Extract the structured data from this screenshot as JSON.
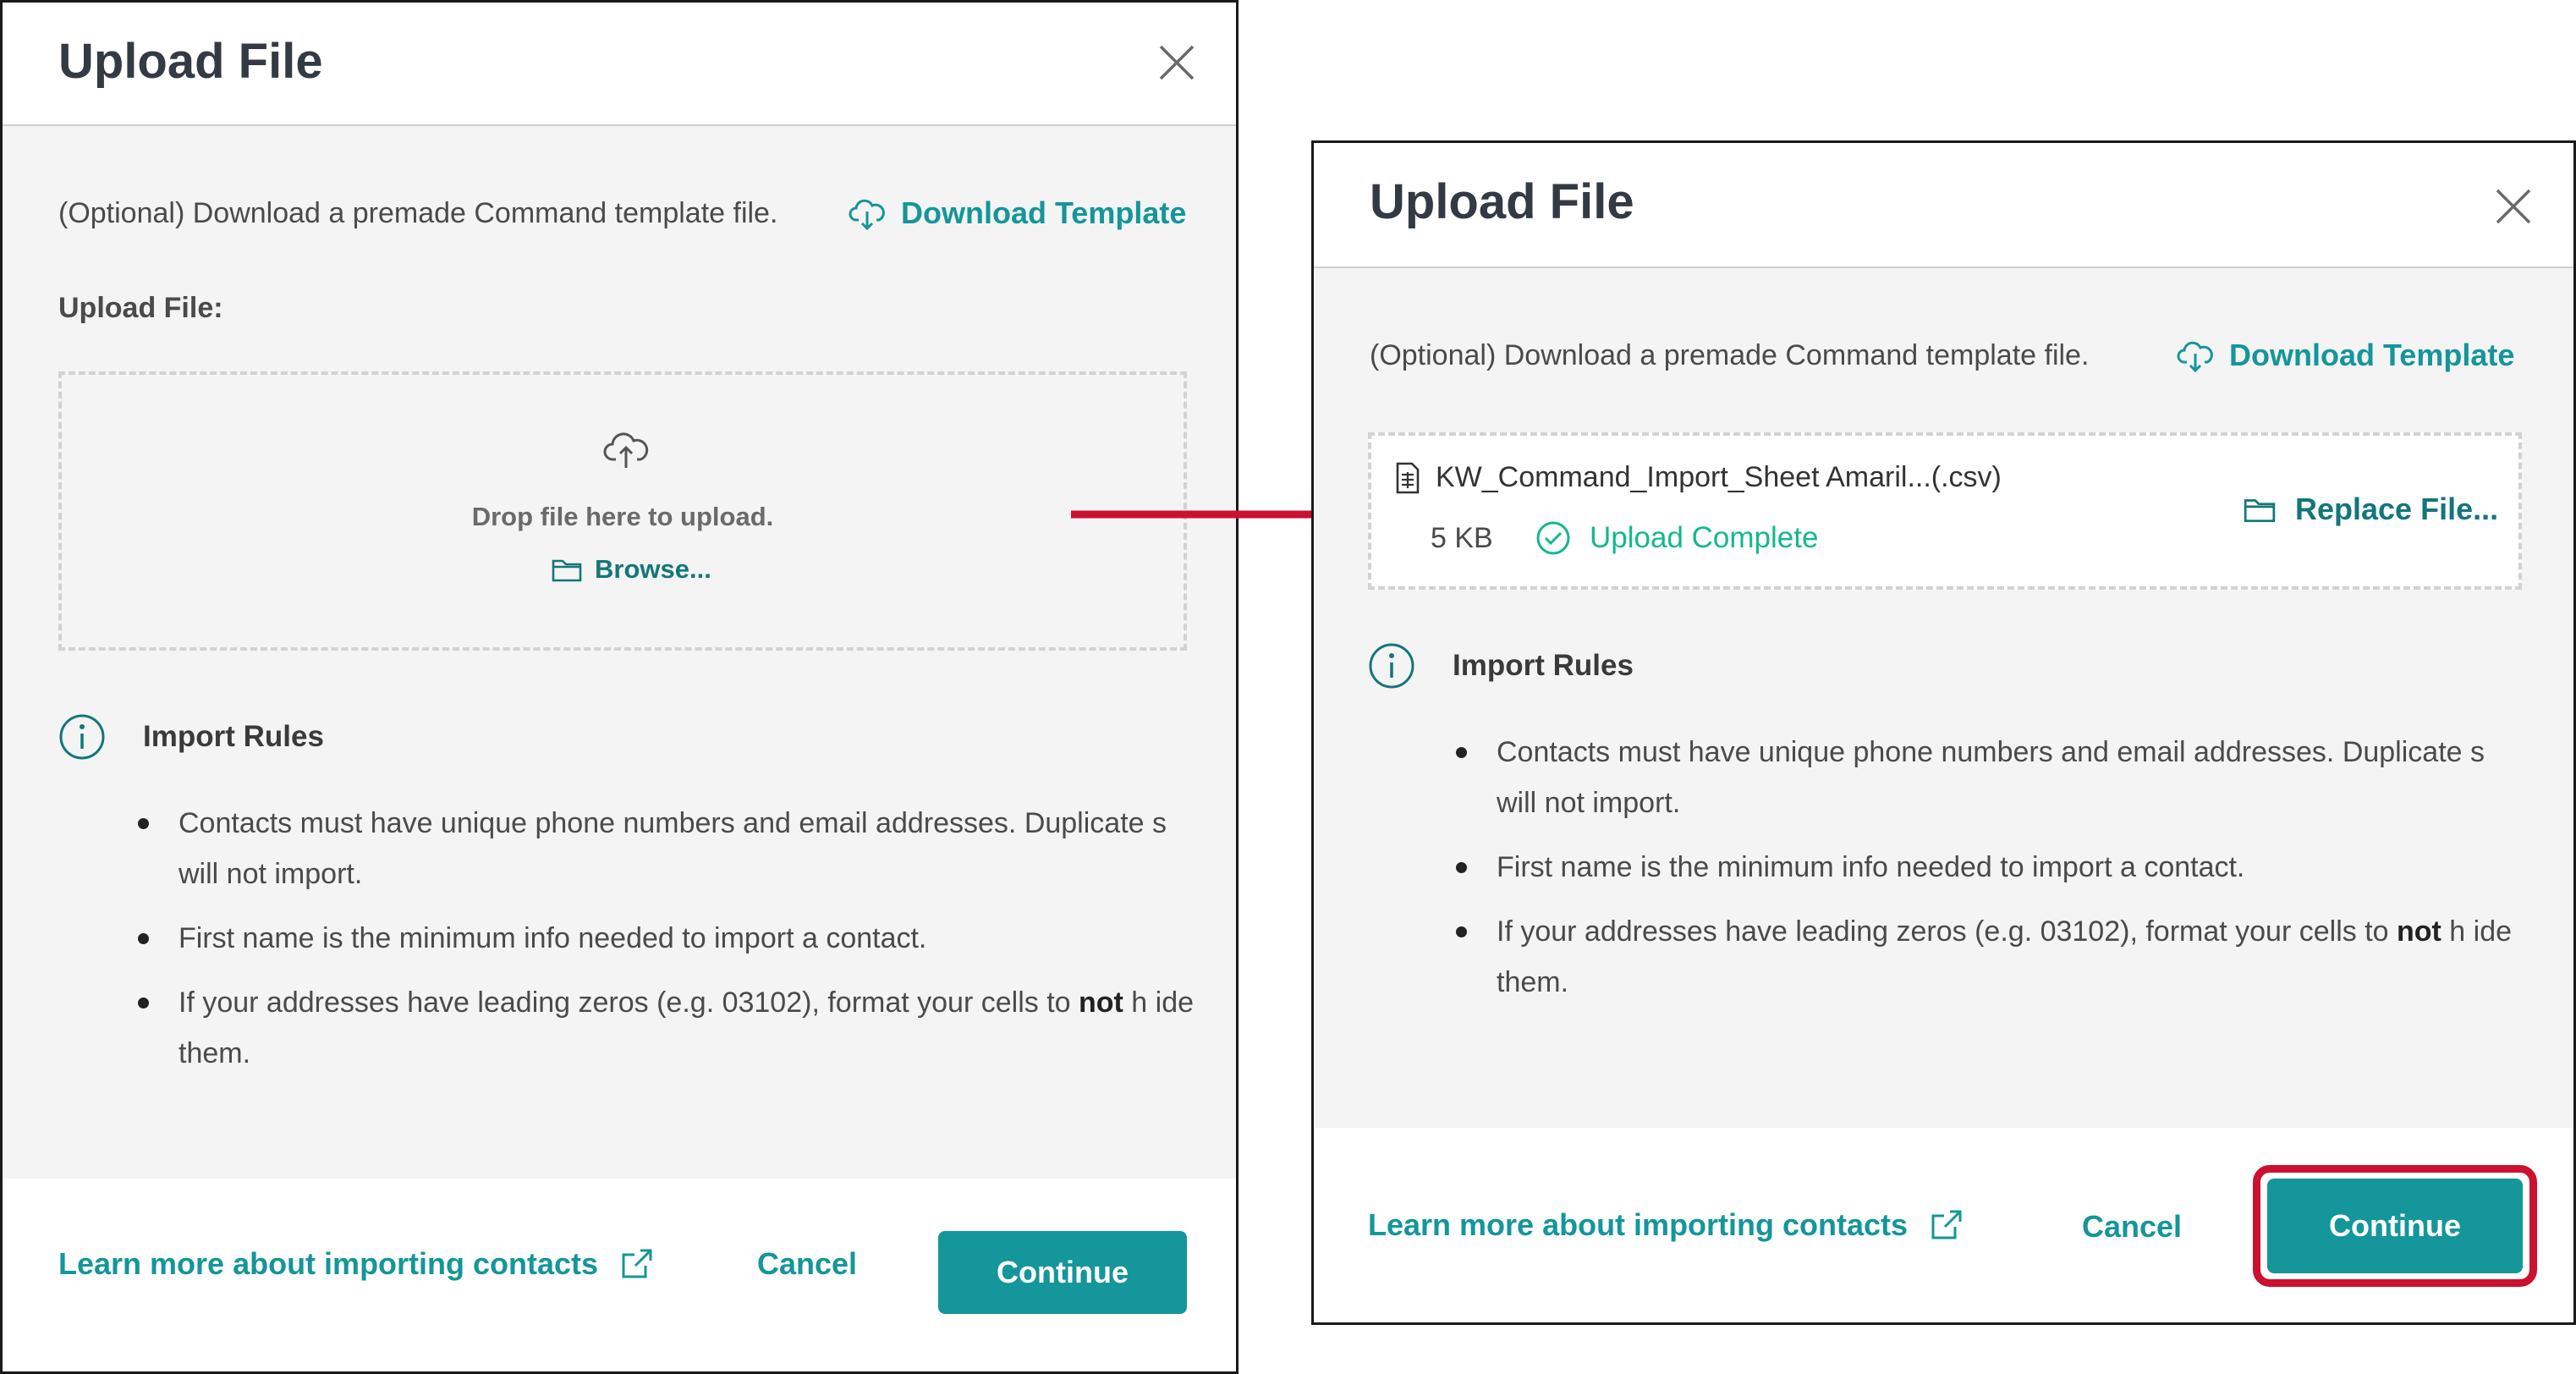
{
  "dialog_before": {
    "title": "Upload File",
    "optional_text": "(Optional) Download a premade Command template file.",
    "download_template_label": "Download Template",
    "upload_file_label": "Upload File:",
    "drop_text": "Drop file here to upload.",
    "browse_label": "Browse...",
    "import_rules_title": "Import Rules",
    "rules": [
      "Contacts must have unique phone numbers and email addresses. Duplicate s will not import.",
      "First name is the minimum info needed to import a contact.",
      "If your addresses have leading zeros (e.g. 03102), format your cells to not h ide them."
    ],
    "learn_more_label": "Learn more about importing contacts",
    "cancel_label": "Cancel",
    "continue_label": "Continue"
  },
  "dialog_after": {
    "title": "Upload File",
    "optional_text": "(Optional) Download a premade Command template file.",
    "download_template_label": "Download Template",
    "file_name": "KW_Command_Import_Sheet Amaril...(.csv)",
    "file_size": "5 KB",
    "upload_status": "Upload Complete",
    "replace_label": "Replace File...",
    "import_rules_title": "Import Rules",
    "rules": [
      "Contacts must have unique phone numbers and email addresses. Duplicate s will not import.",
      "First name is the minimum info needed to import a contact.",
      "If your addresses have leading zeros (e.g. 03102), format your cells to not h ide them."
    ],
    "learn_more_label": "Learn more about importing contacts",
    "cancel_label": "Cancel",
    "continue_label": "Continue"
  },
  "rule3_parts": {
    "before": "If your addresses have leading zeros (e.g. 03102), format your cells to ",
    "bold": "not",
    "after": " h ide them."
  },
  "colors": {
    "accent": "#14969a",
    "success": "#14b88e",
    "annotation_red": "#cc1030",
    "modal_body_bg": "#f4f4f4"
  },
  "icons": [
    "close-icon",
    "cloud-download-icon",
    "cloud-upload-icon",
    "folder-icon",
    "info-icon",
    "external-link-icon",
    "file-icon",
    "check-circle-icon"
  ]
}
